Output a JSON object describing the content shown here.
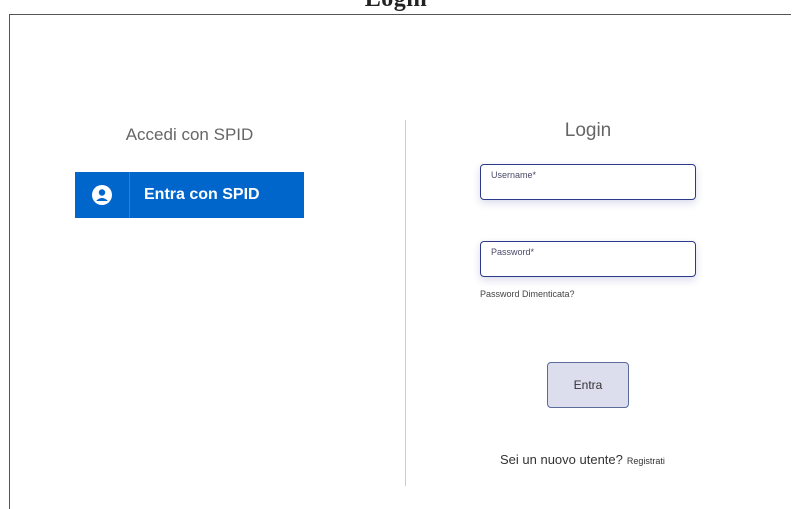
{
  "header": {
    "title": "Login"
  },
  "spid": {
    "title": "Accedi con SPID",
    "button_label": "Entra con SPID",
    "button_icon": "user-icon",
    "accent_color": "#0066cc"
  },
  "login": {
    "title": "Login",
    "username": {
      "label": "Username*",
      "value": ""
    },
    "password": {
      "label": "Password*",
      "value": ""
    },
    "forgot_password_label": "Password Dimenticata?",
    "submit_label": "Entra",
    "register_prompt": "Sei un nuovo utente?",
    "register_link_label": "Registrati"
  }
}
